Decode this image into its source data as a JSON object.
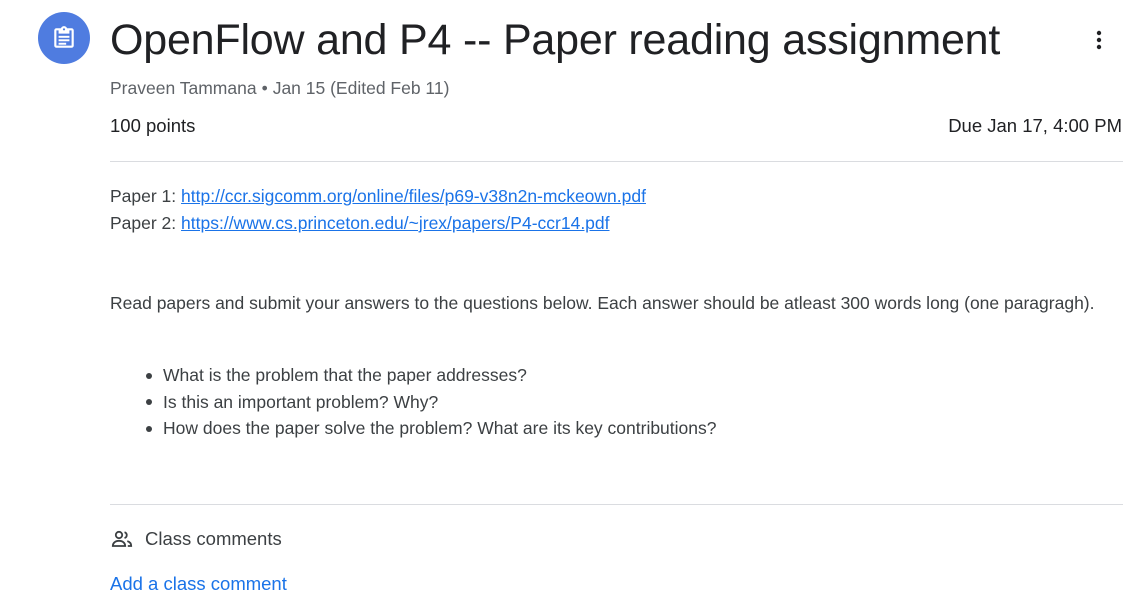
{
  "assignment": {
    "icon": "assignment-icon",
    "title": "OpenFlow and P4 -- Paper reading assignment",
    "author": "Praveen Tammana",
    "separator": "•",
    "date": "Jan 15 (Edited Feb 11)",
    "points": "100 points",
    "due": "Due Jan 17, 4:00 PM",
    "accent_color": "#4f7ce0",
    "link_color": "#1a73e8"
  },
  "papers": [
    {
      "label": "Paper 1: ",
      "url": "http://ccr.sigcomm.org/online/files/p69-v38n2n-mckeown.pdf"
    },
    {
      "label": "Paper 2: ",
      "url": "https://www.cs.princeton.edu/~jrex/papers/P4-ccr14.pdf"
    }
  ],
  "instructions": "Read papers and submit your answers to the questions below. Each answer should be atleast 300 words long (one paragragh).",
  "questions": [
    "What is the problem that the paper addresses?",
    "Is this an important problem? Why?",
    "How does the paper solve the problem? What are its key contributions?"
  ],
  "comments": {
    "icon": "people-icon",
    "header": "Class comments",
    "add_link": "Add a class comment"
  },
  "menu": {
    "icon": "more-vert-icon"
  }
}
